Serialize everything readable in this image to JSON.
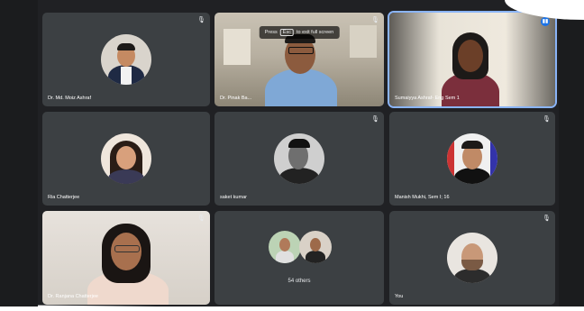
{
  "fullscreen_hint": {
    "press": "Press",
    "key": "Esc",
    "suffix": "to exit full screen"
  },
  "tiles": [
    {
      "name": "Dr. Md. Moiz Ashraf"
    },
    {
      "name": "Dr. Pinak Ba..."
    },
    {
      "name": "Sumaiyya Ashraf- Eng Sem 1"
    },
    {
      "name": "Ria Chatterjee"
    },
    {
      "name": "saket kumar"
    },
    {
      "name": "Manish Mukhi, Sem I; 16"
    },
    {
      "name": "Dr. Ranjana Chatterjee"
    },
    {
      "name": "",
      "others": "54 others"
    },
    {
      "name": "You"
    }
  ],
  "colors": {
    "background": "#202124",
    "tile": "#3c4043",
    "active_outline": "#8ab4f8",
    "speaking": "#1a73e8"
  },
  "icons": {
    "muted": "mic-off-icon",
    "speaking": "audio-level-icon"
  }
}
